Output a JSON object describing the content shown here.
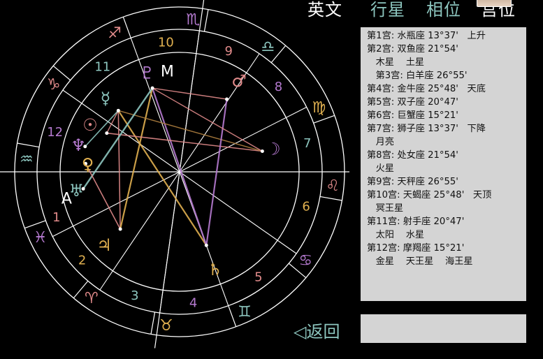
{
  "nav": [
    {
      "label": "英文",
      "color": "#ffffff"
    },
    {
      "label": "行星",
      "color": "#8dc6bf"
    },
    {
      "label": "相位",
      "color": "#8dc6bf"
    },
    {
      "label": "宫位",
      "color": "#ffffff"
    }
  ],
  "houses": [
    {
      "line": "第1宫: 水瓶座 13°37'   上升"
    },
    {
      "line": "第2宫: 双鱼座 21°54'"
    },
    {
      "line": "   木星    土星"
    },
    {
      "line": "   第3宫: 白羊座 26°55'"
    },
    {
      "line": "第4宫: 金牛座 25°48'   天底"
    },
    {
      "line": "第5宫: 双子座 20°47'"
    },
    {
      "line": "第6宫: 巨蟹座 15°21'"
    },
    {
      "line": "第7宫: 狮子座 13°37'   下降"
    },
    {
      "line": "   月亮"
    },
    {
      "line": "第8宫: 处女座 21°54'"
    },
    {
      "line": "   火星"
    },
    {
      "line": "第9宫: 天秤座 26°55'"
    },
    {
      "line": "第10宫: 天蝎座 25°48'   天顶"
    },
    {
      "line": "   冥王星"
    },
    {
      "line": "第11宫: 射手座 20°47'"
    },
    {
      "line": "   太阳    水星"
    },
    {
      "line": "第12宫: 摩羯座 15°21'"
    },
    {
      "line": "   金星    天王星    海王星"
    }
  ],
  "back_label": "◁返回",
  "bottom_text": "                    ",
  "wheel": {
    "signs": [
      "♑",
      "♐",
      "♏",
      "♎",
      "♍",
      "♌",
      "♋",
      "♊",
      "♉",
      "♈",
      "♓",
      "♒"
    ],
    "sign_colors": [
      "#e08a8a",
      "#e08a8a",
      "#b57ad0",
      "#8dc6bf",
      "#e0b050",
      "#e08a8a",
      "#b57ad0",
      "#8dc6bf",
      "#e0b050",
      "#e08a8a",
      "#b57ad0",
      "#8dc6bf"
    ],
    "house_numbers": [
      "1",
      "2",
      "3",
      "4",
      "5",
      "6",
      "7",
      "8",
      "9",
      "10",
      "11",
      "12"
    ],
    "house_colors": [
      "#e08a8a",
      "#e0b050",
      "#8dc6bf",
      "#b57ad0",
      "#e08a8a",
      "#e0b050",
      "#8dc6bf",
      "#b57ad0",
      "#e08a8a",
      "#e0b050",
      "#8dc6bf",
      "#b57ad0"
    ],
    "planets": [
      {
        "glyph": "♄",
        "name": "saturn",
        "color": "#e0b050"
      },
      {
        "glyph": "♃",
        "name": "jupiter",
        "color": "#e0b050"
      },
      {
        "glyph": "☽",
        "name": "moon",
        "color": "#b57ad0"
      },
      {
        "glyph": "♂",
        "name": "mars",
        "color": "#e08a8a"
      },
      {
        "glyph": "♀",
        "name": "venus",
        "color": "#e0b050"
      },
      {
        "glyph": "☉",
        "name": "sun",
        "color": "#e08a8a"
      },
      {
        "glyph": "☿",
        "name": "mercury",
        "color": "#8dc6bf"
      },
      {
        "glyph": "♇",
        "name": "pluto",
        "color": "#b57ad0"
      },
      {
        "glyph": "♆",
        "name": "neptune",
        "color": "#b57ad0"
      },
      {
        "glyph": "♅",
        "name": "uranus",
        "color": "#8dc6bf"
      }
    ],
    "angle_labels": {
      "asc": "A",
      "mc": "M"
    }
  }
}
